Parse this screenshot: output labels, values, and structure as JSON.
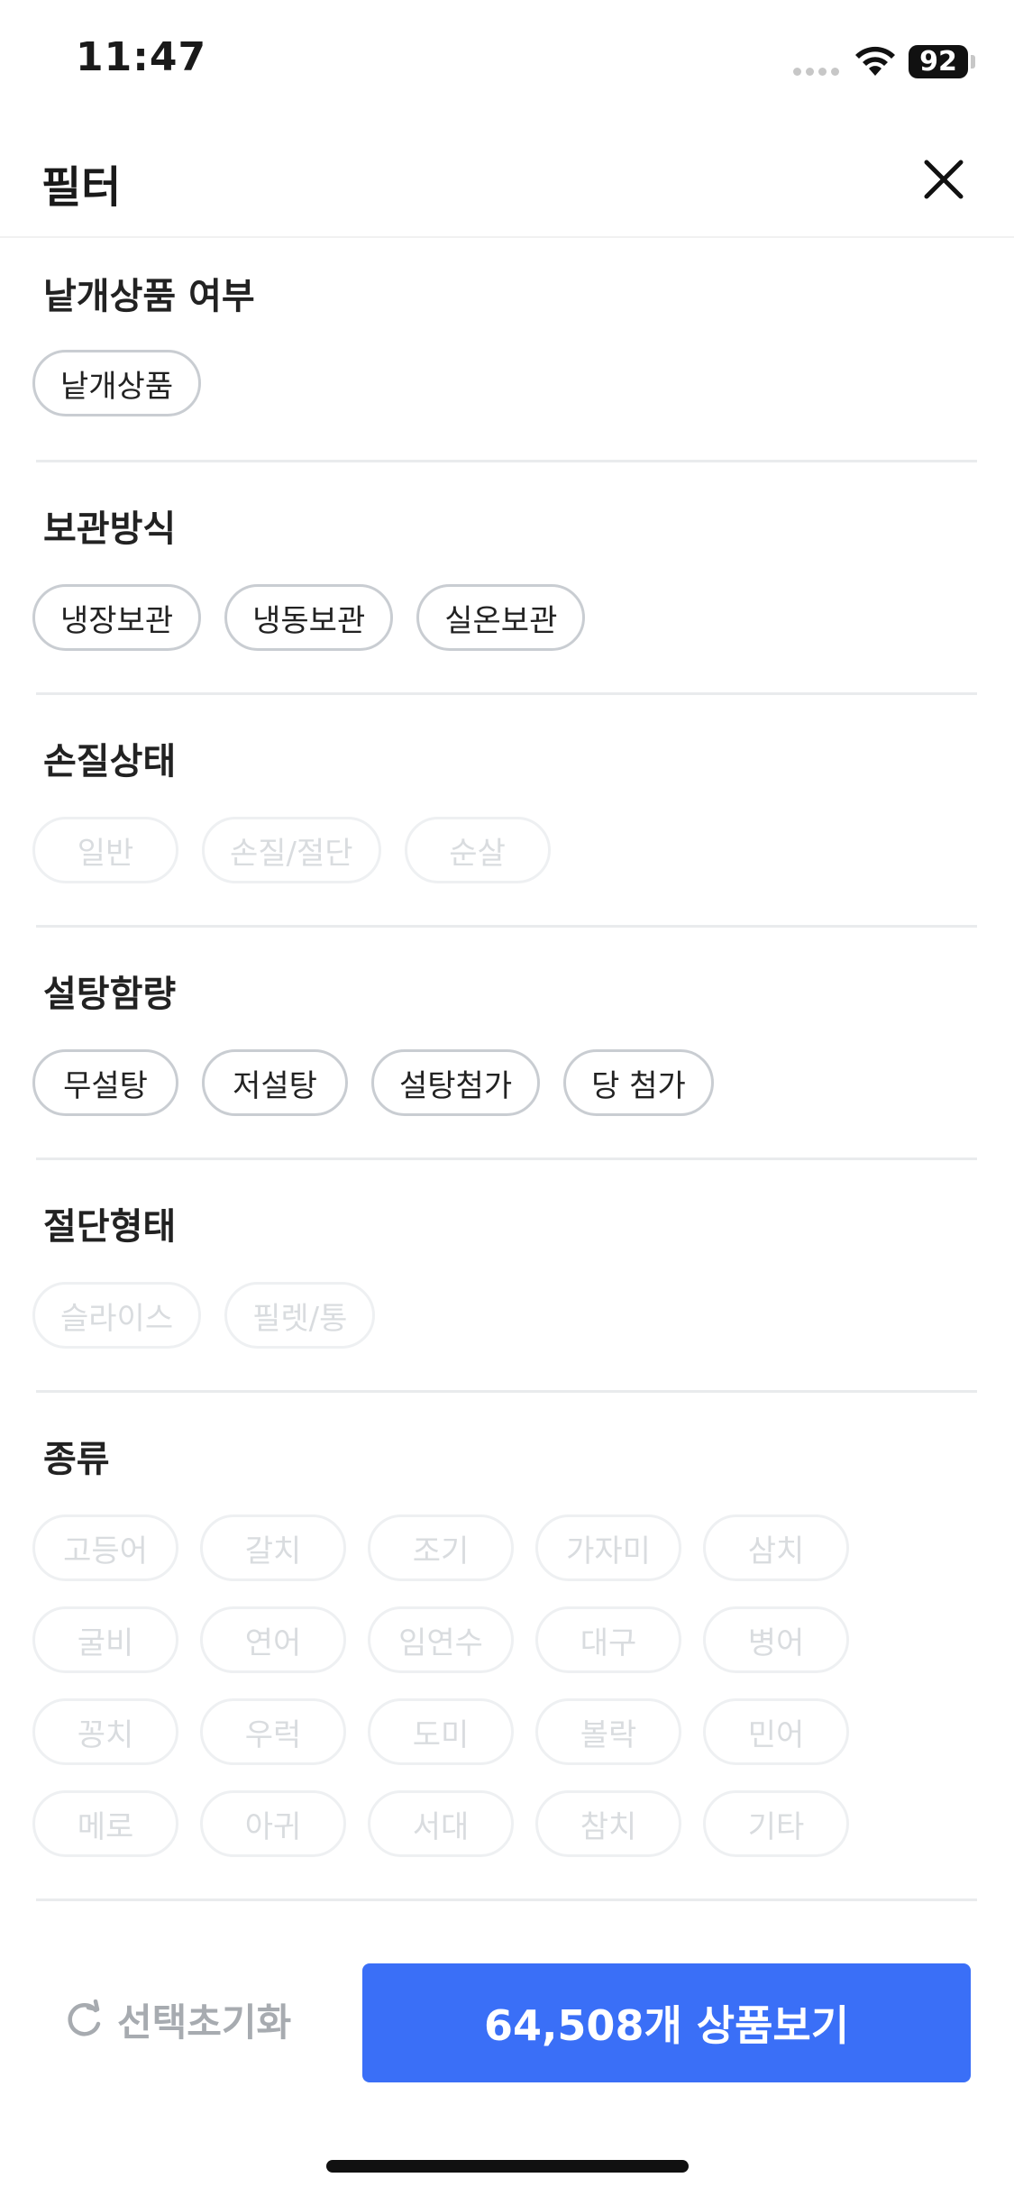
{
  "status": {
    "time": "11:47",
    "battery": "92"
  },
  "header": {
    "title": "필터"
  },
  "sections": [
    {
      "title": "낱개상품 여부",
      "chips": [
        {
          "label": "낱개상품",
          "enabled": true
        }
      ]
    },
    {
      "title": "보관방식",
      "chips": [
        {
          "label": "냉장보관",
          "enabled": true
        },
        {
          "label": "냉동보관",
          "enabled": true
        },
        {
          "label": "실온보관",
          "enabled": true
        }
      ]
    },
    {
      "title": "손질상태",
      "chips": [
        {
          "label": "일반",
          "enabled": false
        },
        {
          "label": "손질/절단",
          "enabled": false
        },
        {
          "label": "순살",
          "enabled": false
        }
      ]
    },
    {
      "title": "설탕함량",
      "chips": [
        {
          "label": "무설탕",
          "enabled": true
        },
        {
          "label": "저설탕",
          "enabled": true
        },
        {
          "label": "설탕첨가",
          "enabled": true
        },
        {
          "label": "당 첨가",
          "enabled": true
        }
      ]
    },
    {
      "title": "절단형태",
      "chips": [
        {
          "label": "슬라이스",
          "enabled": false
        },
        {
          "label": "필렛/통",
          "enabled": false
        }
      ]
    },
    {
      "title": "종류",
      "chips": [
        {
          "label": "고등어",
          "enabled": false
        },
        {
          "label": "갈치",
          "enabled": false
        },
        {
          "label": "조기",
          "enabled": false
        },
        {
          "label": "가자미",
          "enabled": false
        },
        {
          "label": "삼치",
          "enabled": false
        },
        {
          "label": "굴비",
          "enabled": false
        },
        {
          "label": "연어",
          "enabled": false
        },
        {
          "label": "임연수",
          "enabled": false
        },
        {
          "label": "대구",
          "enabled": false
        },
        {
          "label": "병어",
          "enabled": false
        },
        {
          "label": "꽁치",
          "enabled": false
        },
        {
          "label": "우럭",
          "enabled": false
        },
        {
          "label": "도미",
          "enabled": false
        },
        {
          "label": "볼락",
          "enabled": false
        },
        {
          "label": "민어",
          "enabled": false
        },
        {
          "label": "메로",
          "enabled": false
        },
        {
          "label": "아귀",
          "enabled": false
        },
        {
          "label": "서대",
          "enabled": false
        },
        {
          "label": "참치",
          "enabled": false
        },
        {
          "label": "기타",
          "enabled": false
        }
      ]
    }
  ],
  "footer": {
    "reset_label": "선택초기화",
    "cta_label": "64,508개 상품보기"
  },
  "colors": {
    "accent": "#3a6ff7",
    "chip_border": "#c9cdd2",
    "chip_disabled": "#eef0f2"
  }
}
